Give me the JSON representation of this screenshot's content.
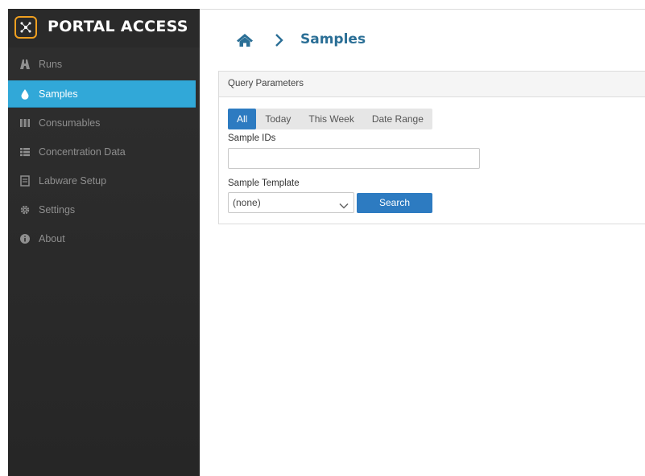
{
  "brand": {
    "title": "PORTAL ACCESS",
    "logo_icon": "network-icon",
    "accent": "#f0a020"
  },
  "sidebar": {
    "items": [
      {
        "label": "Runs",
        "icon": "road-icon",
        "active": false
      },
      {
        "label": "Samples",
        "icon": "droplet-icon",
        "active": true
      },
      {
        "label": "Consumables",
        "icon": "barcode-icon",
        "active": false
      },
      {
        "label": "Concentration Data",
        "icon": "list-icon",
        "active": false
      },
      {
        "label": "Labware Setup",
        "icon": "document-icon",
        "active": false
      },
      {
        "label": "Settings",
        "icon": "gear-icon",
        "active": false
      },
      {
        "label": "About",
        "icon": "info-icon",
        "active": false
      }
    ],
    "active_color": "#31a8d8"
  },
  "breadcrumb": {
    "home_icon": "home-icon",
    "separator_icon": "chevron-right-icon",
    "page_title": "Samples"
  },
  "panel": {
    "heading": "Query Parameters",
    "tabs": [
      {
        "label": "All",
        "active": true
      },
      {
        "label": "Today",
        "active": false
      },
      {
        "label": "This Week",
        "active": false
      },
      {
        "label": "Date Range",
        "active": false
      }
    ],
    "sample_ids_label": "Sample IDs",
    "sample_ids_value": "",
    "template_label": "Sample Template",
    "template_value": "(none)",
    "search_label": "Search",
    "primary_color": "#2d7bc1"
  }
}
